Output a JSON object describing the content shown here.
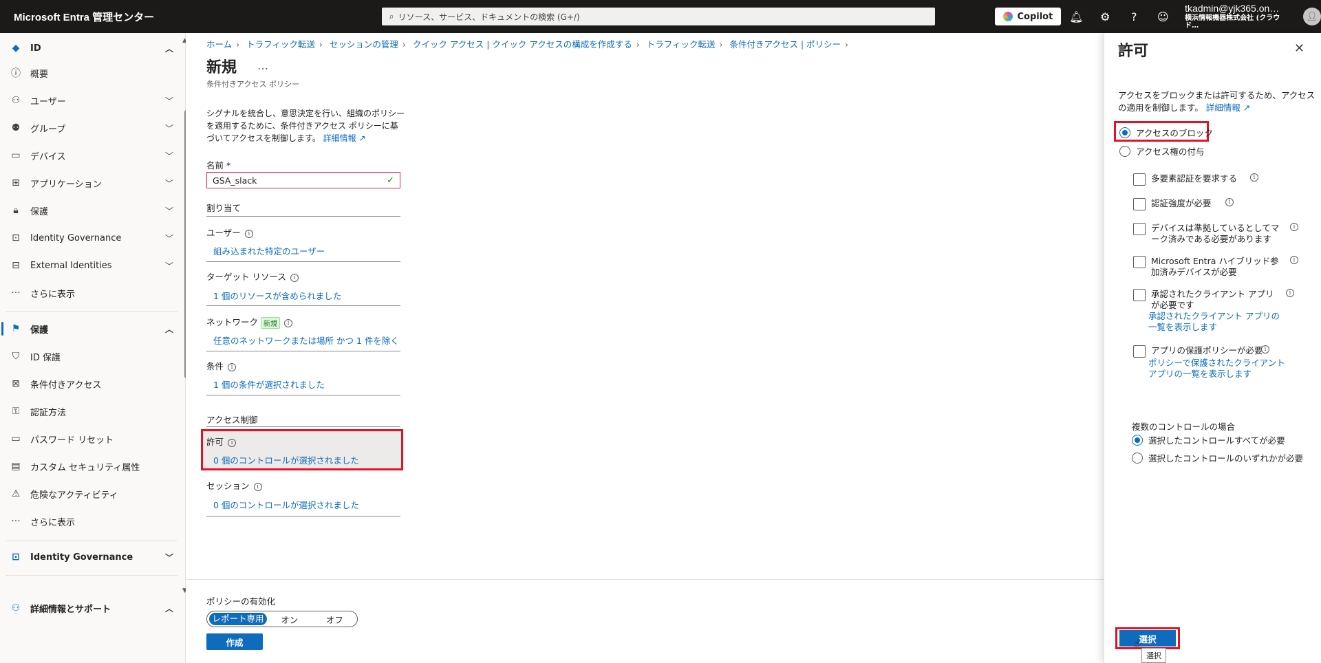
{
  "topbar": {
    "brand": "Microsoft Entra 管理センター",
    "search_placeholder": "リソース、サービス、ドキュメントの検索 (G+/)",
    "copilot_label": "Copilot",
    "user": "tkadmin@yjk365.on…",
    "org": "横浜情報機器株式会社 (クラウド…"
  },
  "sidebar": {
    "items": [
      {
        "label": "ID"
      },
      {
        "label": "概要"
      },
      {
        "label": "ユーザー"
      },
      {
        "label": "グループ"
      },
      {
        "label": "デバイス"
      },
      {
        "label": "アプリケーション"
      },
      {
        "label": "保護"
      },
      {
        "label": "Identity Governance"
      },
      {
        "label": "External Identities"
      },
      {
        "label": "さらに表示"
      },
      {
        "label": "保護"
      },
      {
        "label": "ID 保護"
      },
      {
        "label": "条件付きアクセス"
      },
      {
        "label": "認証方法"
      },
      {
        "label": "パスワード リセット"
      },
      {
        "label": "カスタム セキュリティ属性"
      },
      {
        "label": "危険なアクティビティ"
      },
      {
        "label": "さらに表示"
      },
      {
        "label": "Identity Governance"
      },
      {
        "label": "詳細情報とサポート"
      }
    ]
  },
  "breadcrumb": [
    "ホーム",
    "トラフィック転送",
    "セッションの管理",
    "クイック アクセス | クイック アクセスの構成を作成する",
    "トラフィック転送",
    "条件付きアクセス | ポリシー"
  ],
  "page": {
    "title": "新規",
    "more": "…",
    "subtitle": "条件付きアクセス ポリシー",
    "description": "シグナルを統合し、意思決定を行い、組織のポリシーを適用するために、条件付きアクセス ポリシーに基づいてアクセスを制御します。",
    "learn_more": "詳細情報",
    "name_label": "名前 *",
    "name_value": "GSA_slack",
    "assignments_label": "割り当て",
    "users_label": "ユーザー",
    "users_value": "組み込まれた特定のユーザー",
    "target_label": "ターゲット リソース",
    "target_value": "1 個のリソースが含められました",
    "network_label": "ネットワーク",
    "network_badge": "新規",
    "network_value": "任意のネットワークまたは場所 かつ 1 件を除く",
    "conditions_label": "条件",
    "conditions_value": "1 個の条件が選択されました",
    "access_controls_label": "アクセス制御",
    "grant_label": "許可",
    "grant_value": "0 個のコントロールが選択されました",
    "session_label": "セッション",
    "session_value": "0 個のコントロールが選択されました",
    "enable_label": "ポリシーの有効化",
    "toggle": [
      "レポート専用",
      "オン",
      "オフ"
    ],
    "create_label": "作成"
  },
  "panel": {
    "title": "許可",
    "description": "アクセスをブロックまたは許可するため、アクセスの適用を制御します。",
    "learn_more": "詳細情報",
    "block_label": "アクセスのブロック",
    "grant_label": "アクセス権の付与",
    "checks": [
      {
        "label": "多要素認証を要求する"
      },
      {
        "label": "認証強度が必要"
      },
      {
        "label": "デバイスは準拠しているとしてマーク済みである必要があります"
      },
      {
        "label": "Microsoft Entra ハイブリッド参加済みデバイスが必要"
      },
      {
        "label": "承認されたクライアント アプリが必要です",
        "link": "承認されたクライアント アプリの一覧を表示します"
      },
      {
        "label": "アプリの保護ポリシーが必要",
        "link": "ポリシーで保護されたクライアント アプリの一覧を表示します"
      }
    ],
    "multi_label": "複数のコントロールの場合",
    "require_all": "選択したコントロールすべてが必要",
    "require_one": "選択したコントロールのいずれかが必要",
    "select_label": "選択",
    "tooltip": "選択"
  }
}
